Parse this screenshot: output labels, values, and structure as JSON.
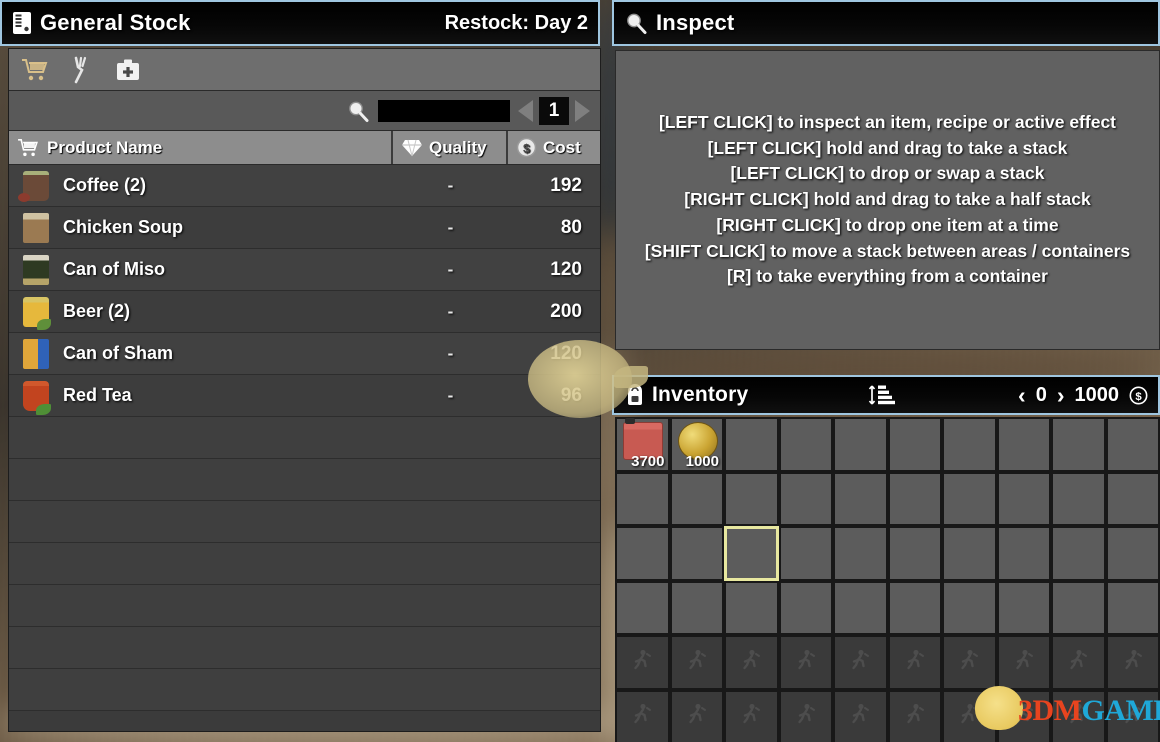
{
  "stock": {
    "title": "General Stock",
    "title_icon": "vending-machine-icon",
    "restock": "Restock: Day 2",
    "tabs": [
      {
        "name": "shopping-cart",
        "glyph": "🛒",
        "selected": true
      },
      {
        "name": "food-fork",
        "glyph": "🍴",
        "selected": false
      },
      {
        "name": "medkit",
        "glyph": "⚕",
        "selected": false
      }
    ],
    "search": {
      "value": "",
      "placeholder": ""
    },
    "page": "1",
    "prev_label": "◀",
    "next_label": "▶",
    "columns": {
      "name": "Product Name",
      "quality": "Quality",
      "cost": "Cost"
    },
    "rows": [
      {
        "name": "Coffee (2)",
        "quality": "-",
        "cost": "192",
        "sprite": "sp-coffee"
      },
      {
        "name": "Chicken Soup",
        "quality": "-",
        "cost": "80",
        "sprite": "sp-soup"
      },
      {
        "name": "Can of Miso",
        "quality": "-",
        "cost": "120",
        "sprite": "sp-miso"
      },
      {
        "name": "Beer (2)",
        "quality": "-",
        "cost": "200",
        "sprite": "sp-beer"
      },
      {
        "name": "Can of Sham",
        "quality": "-",
        "cost": "120",
        "sprite": "sp-sham"
      },
      {
        "name": "Red Tea",
        "quality": "-",
        "cost": "96",
        "sprite": "sp-redtea"
      }
    ],
    "empty_row_count": 7
  },
  "inspect": {
    "title": "Inspect",
    "title_icon": "magnifier-icon",
    "hints": [
      "[LEFT CLICK] to inspect an item, recipe or active effect",
      "[LEFT CLICK] hold and drag to take a stack",
      "[LEFT CLICK] to drop or swap a stack",
      "[RIGHT CLICK] hold and drag to take a half stack",
      "[RIGHT CLICK] to drop one item at a time",
      "[SHIFT CLICK] to move a stack between areas / containers",
      "[R] to take everything from a container"
    ]
  },
  "inventory": {
    "title": "Inventory",
    "title_icon": "backpack-icon",
    "sort_icon": "sort-icon",
    "prev_label": "‹",
    "next_label": "›",
    "page": "0",
    "currency": "1000",
    "currency_icon": "Ⓢ",
    "columns": 10,
    "slots": [
      {
        "index": 0,
        "item": "gas-can",
        "art": "art-gascan",
        "qty": "3700",
        "state": "filled"
      },
      {
        "index": 1,
        "item": "gold-coin",
        "art": "art-coin",
        "qty": "1000",
        "state": "filled"
      },
      {
        "index": 22,
        "item": null,
        "art": null,
        "qty": "",
        "state": "selected"
      }
    ],
    "open_row_count": 4,
    "locked_row_count": 2,
    "locked_icon": "runner-icon",
    "locked_glyph": "🏃"
  },
  "watermark": {
    "part1": "3DM",
    "part2": "GAME"
  },
  "colors": {
    "panel_bg": "#3b3b3b",
    "header_bg": "#8d8d8d",
    "titlebar_border": "#9fc6e0",
    "slot_bg": "#5c5c5c",
    "slot_locked_bg": "#3a3a3a",
    "selection": "#e8e8a0",
    "accent_tab": "#d9c08a"
  }
}
